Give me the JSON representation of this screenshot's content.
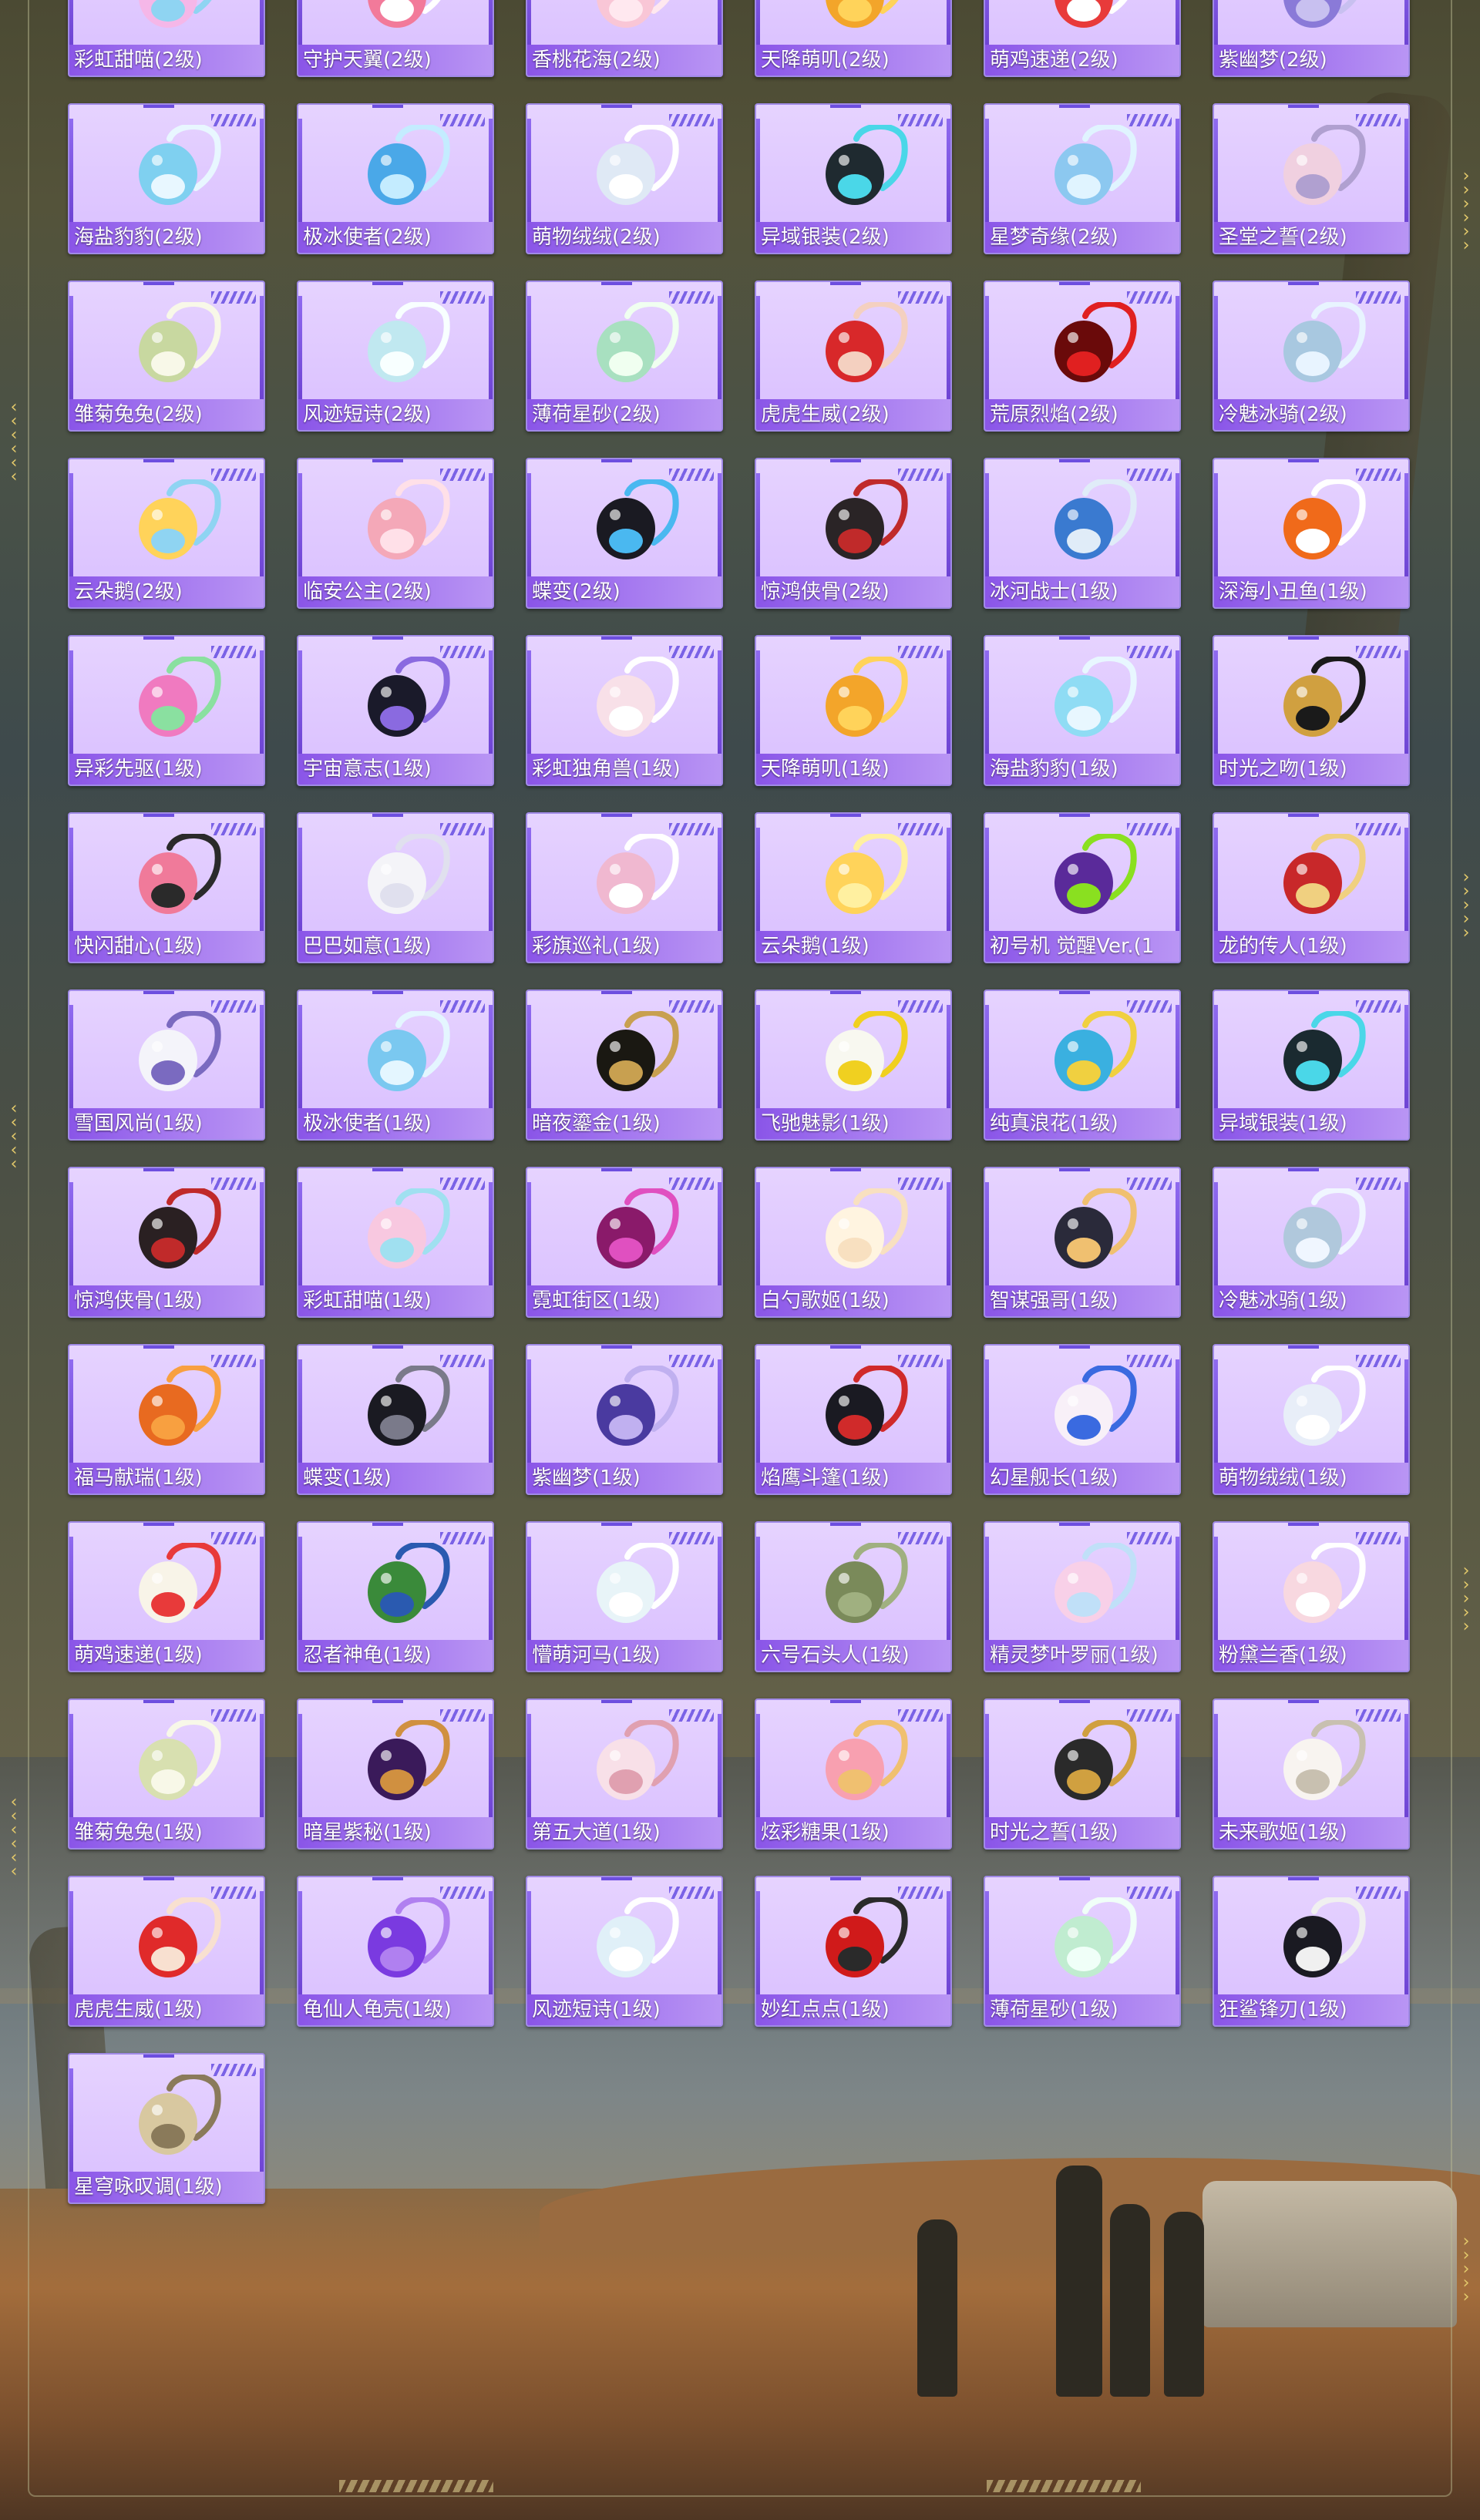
{
  "colors": {
    "card_bg": "#dcc4ff",
    "label_bar": "#9a68ee",
    "accent": "#6d4ee0",
    "frame_gold": "#e2c86a"
  },
  "items": [
    {
      "name": "彩虹甜喵(2级)",
      "icon": "rainbow-cat-backpack-icon",
      "c1": "#f5b7e8",
      "c2": "#8fd4f2"
    },
    {
      "name": "守护天翼(2级)",
      "icon": "guardian-wing-backpack-icon",
      "c1": "#f27a9a",
      "c2": "#ffffff"
    },
    {
      "name": "香桃花海(2级)",
      "icon": "peach-flower-backpack-icon",
      "c1": "#f9c6d6",
      "c2": "#ffe8ef"
    },
    {
      "name": "天降萌叽(2级)",
      "icon": "cute-chick-backpack-icon",
      "c1": "#f3a52a",
      "c2": "#ffd35a"
    },
    {
      "name": "萌鸡速递(2级)",
      "icon": "chick-delivery-backpack-icon",
      "c1": "#e83a3a",
      "c2": "#ffffff"
    },
    {
      "name": "紫幽梦(2级)",
      "icon": "purple-dream-backpack-icon",
      "c1": "#8a7ad8",
      "c2": "#c8c0f0"
    },
    {
      "name": "海盐豹豹(2级)",
      "icon": "sea-salt-seal-backpack-icon",
      "c1": "#7fd0f0",
      "c2": "#e8f7ff"
    },
    {
      "name": "极冰使者(2级)",
      "icon": "ice-envoy-backpack-icon",
      "c1": "#4aa8e8",
      "c2": "#c4ecff"
    },
    {
      "name": "萌物绒绒(2级)",
      "icon": "plush-pet-backpack-icon",
      "c1": "#dfe9f5",
      "c2": "#ffffff"
    },
    {
      "name": "异域银装(2级)",
      "icon": "exotic-silver-backpack-icon",
      "c1": "#1f2a30",
      "c2": "#4ad7e8"
    },
    {
      "name": "星梦奇缘(2级)",
      "icon": "star-dream-backpack-icon",
      "c1": "#8cc8f0",
      "c2": "#e0f4ff"
    },
    {
      "name": "圣堂之誓(2级)",
      "icon": "sanctum-oath-backpack-icon",
      "c1": "#f0d0e0",
      "c2": "#b0a0d0"
    },
    {
      "name": "雏菊兔兔(2级)",
      "icon": "daisy-bunny-backpack-icon",
      "c1": "#c8d8a0",
      "c2": "#f8f8e8"
    },
    {
      "name": "风迹短诗(2级)",
      "icon": "wind-poem-backpack-icon",
      "c1": "#c0e8f0",
      "c2": "#f8ffff"
    },
    {
      "name": "薄荷星砂(2级)",
      "icon": "mint-stardust-backpack-icon",
      "c1": "#a8e0c0",
      "c2": "#f0fff0"
    },
    {
      "name": "虎虎生威(2级)",
      "icon": "tiger-backpack-icon",
      "c1": "#d8282a",
      "c2": "#f4d0c0"
    },
    {
      "name": "荒原烈焰(2级)",
      "icon": "wasteland-flame-backpack-icon",
      "c1": "#6a0a0a",
      "c2": "#e02020"
    },
    {
      "name": "冷魅冰骑(2级)",
      "icon": "ice-knight-backpack-icon",
      "c1": "#a8c8e0",
      "c2": "#e8f4ff"
    },
    {
      "name": "云朵鹅(2级)",
      "icon": "cloud-goose-backpack-icon",
      "c1": "#ffd35a",
      "c2": "#8fd4f2"
    },
    {
      "name": "临安公主(2级)",
      "icon": "linan-princess-backpack-icon",
      "c1": "#f4a8b8",
      "c2": "#ffe0e8"
    },
    {
      "name": "蝶变(2级)",
      "icon": "butterfly-backpack-icon",
      "c1": "#1a1a22",
      "c2": "#4ab8f0"
    },
    {
      "name": "惊鸿侠骨(2级)",
      "icon": "swift-hero-backpack-icon",
      "c1": "#2a2426",
      "c2": "#c02a2a"
    },
    {
      "name": "冰河战士(1级)",
      "icon": "glacier-warrior-backpack-icon",
      "c1": "#3a7ad0",
      "c2": "#e0ecf8"
    },
    {
      "name": "深海小丑鱼(1级)",
      "icon": "clownfish-backpack-icon",
      "c1": "#f06a1a",
      "c2": "#ffffff"
    },
    {
      "name": "异彩先驱(1级)",
      "icon": "colorful-pioneer-backpack-icon",
      "c1": "#f07ac0",
      "c2": "#8ae0a0"
    },
    {
      "name": "宇宙意志(1级)",
      "icon": "cosmic-will-backpack-icon",
      "c1": "#1a1a2a",
      "c2": "#8a6ae0"
    },
    {
      "name": "彩虹独角兽(1级)",
      "icon": "unicorn-backpack-icon",
      "c1": "#f8e0e8",
      "c2": "#ffffff"
    },
    {
      "name": "天降萌叽(1级)",
      "icon": "cute-chick-backpack-icon",
      "c1": "#f3a52a",
      "c2": "#ffd35a"
    },
    {
      "name": "海盐豹豹(1级)",
      "icon": "sea-salt-seal-backpack-icon",
      "c1": "#8fdcf4",
      "c2": "#e8f7ff"
    },
    {
      "name": "时光之吻(1级)",
      "icon": "time-kiss-backpack-icon",
      "c1": "#d0a040",
      "c2": "#1a1a1a"
    },
    {
      "name": "快闪甜心(1级)",
      "icon": "flash-sweetheart-backpack-icon",
      "c1": "#f07a9a",
      "c2": "#2a2a2a"
    },
    {
      "name": "巴巴如意(1级)",
      "icon": "baba-ruyi-backpack-icon",
      "c1": "#f4f4f8",
      "c2": "#e0e0ee"
    },
    {
      "name": "彩旗巡礼(1级)",
      "icon": "flag-parade-backpack-icon",
      "c1": "#f0b8d0",
      "c2": "#ffffff"
    },
    {
      "name": "云朵鹅(1级)",
      "icon": "cloud-goose-backpack-icon",
      "c1": "#ffd35a",
      "c2": "#fff0a0"
    },
    {
      "name": "初号机 觉醒Ver.(1",
      "icon": "unit-01-backpack-icon",
      "c1": "#5a2a9a",
      "c2": "#8ae020"
    },
    {
      "name": "龙的传人(1级)",
      "icon": "dragon-heir-backpack-icon",
      "c1": "#c8282a",
      "c2": "#f0d080"
    },
    {
      "name": "雪国风尚(1级)",
      "icon": "snow-style-backpack-icon",
      "c1": "#f4f4fa",
      "c2": "#7a6ac0"
    },
    {
      "name": "极冰使者(1级)",
      "icon": "ice-envoy-backpack-icon",
      "c1": "#7ac8f0",
      "c2": "#e4f6ff"
    },
    {
      "name": "暗夜鎏金(1级)",
      "icon": "dark-gold-backpack-icon",
      "c1": "#1a1812",
      "c2": "#c8a050"
    },
    {
      "name": "飞驰魅影(1级)",
      "icon": "speed-phantom-backpack-icon",
      "c1": "#f8f8f0",
      "c2": "#f0d020"
    },
    {
      "name": "纯真浪花(1级)",
      "icon": "pure-wave-backpack-icon",
      "c1": "#3ab0e0",
      "c2": "#f0d040"
    },
    {
      "name": "异域银装(1级)",
      "icon": "exotic-silver-backpack-icon",
      "c1": "#1a2a30",
      "c2": "#4ad7e8"
    },
    {
      "name": "惊鸿侠骨(1级)",
      "icon": "swift-hero-backpack-icon",
      "c1": "#2a2022",
      "c2": "#c02a2a"
    },
    {
      "name": "彩虹甜喵(1级)",
      "icon": "rainbow-cat-backpack-icon",
      "c1": "#f8c8e0",
      "c2": "#a0e0f0"
    },
    {
      "name": "霓虹街区(1级)",
      "icon": "neon-street-backpack-icon",
      "c1": "#8a1a6a",
      "c2": "#e050c0"
    },
    {
      "name": "白勺歌姬(1级)",
      "icon": "white-diva-backpack-icon",
      "c1": "#fff4e0",
      "c2": "#f8e0c0"
    },
    {
      "name": "智谋强哥(1级)",
      "icon": "clever-bro-backpack-icon",
      "c1": "#2a2a3a",
      "c2": "#f0c070"
    },
    {
      "name": "冷魅冰骑(1级)",
      "icon": "ice-knight-backpack-icon",
      "c1": "#b0c8dc",
      "c2": "#f0f6ff"
    },
    {
      "name": "福马献瑞(1级)",
      "icon": "lucky-horse-backpack-icon",
      "c1": "#e86a20",
      "c2": "#f8a040"
    },
    {
      "name": "蝶变(1级)",
      "icon": "butterfly-backpack-icon",
      "c1": "#1a1a22",
      "c2": "#7a7a8a"
    },
    {
      "name": "紫幽梦(1级)",
      "icon": "purple-dream-backpack-icon",
      "c1": "#4a3aa0",
      "c2": "#c0b0f0"
    },
    {
      "name": "焰鹰斗篷(1级)",
      "icon": "flame-eagle-backpack-icon",
      "c1": "#1a1a22",
      "c2": "#d02a2a"
    },
    {
      "name": "幻星舰长(1级)",
      "icon": "star-captain-backpack-icon",
      "c1": "#f8f0f8",
      "c2": "#3a6ae0"
    },
    {
      "name": "萌物绒绒(1级)",
      "icon": "plush-pet-backpack-icon",
      "c1": "#e8eef8",
      "c2": "#ffffff"
    },
    {
      "name": "萌鸡速递(1级)",
      "icon": "chick-delivery-backpack-icon",
      "c1": "#f8f4e8",
      "c2": "#e83a3a"
    },
    {
      "name": "忍者神龟(1级)",
      "icon": "ninja-turtle-backpack-icon",
      "c1": "#3a8a3a",
      "c2": "#2a5ab0"
    },
    {
      "name": "懵萌河马(1级)",
      "icon": "hippo-backpack-icon",
      "c1": "#e8f4f8",
      "c2": "#ffffff"
    },
    {
      "name": "六号石头人(1级)",
      "icon": "stone-golem-backpack-icon",
      "c1": "#7a8a5a",
      "c2": "#a0b080"
    },
    {
      "name": "精灵梦叶罗丽(1级)",
      "icon": "fairy-dream-backpack-icon",
      "c1": "#f8d0e8",
      "c2": "#c0e0f8"
    },
    {
      "name": "粉黛兰香(1级)",
      "icon": "pink-orchid-backpack-icon",
      "c1": "#f8d8e0",
      "c2": "#ffffff"
    },
    {
      "name": "雏菊兔兔(1级)",
      "icon": "daisy-bunny-backpack-icon",
      "c1": "#d8e0b0",
      "c2": "#f8f8e8"
    },
    {
      "name": "暗星紫秘(1级)",
      "icon": "dark-star-backpack-icon",
      "c1": "#3a1a5a",
      "c2": "#d09040"
    },
    {
      "name": "第五大道(1级)",
      "icon": "fifth-avenue-backpack-icon",
      "c1": "#f8e0e8",
      "c2": "#e0a0b0"
    },
    {
      "name": "炫彩糖果(1级)",
      "icon": "candy-backpack-icon",
      "c1": "#f8a0b0",
      "c2": "#f0c070"
    },
    {
      "name": "时光之誓(1级)",
      "icon": "time-oath-backpack-icon",
      "c1": "#2a2a2a",
      "c2": "#d0a040"
    },
    {
      "name": "未来歌姬(1级)",
      "icon": "future-diva-backpack-icon",
      "c1": "#f8f4f0",
      "c2": "#c8c0b0"
    },
    {
      "name": "虎虎生威(1级)",
      "icon": "tiger-backpack-icon",
      "c1": "#e02a2a",
      "c2": "#f8e0d0"
    },
    {
      "name": "龟仙人龟壳(1级)",
      "icon": "turtle-shell-backpack-icon",
      "c1": "#7a3ae0",
      "c2": "#b080f0"
    },
    {
      "name": "风迹短诗(1级)",
      "icon": "wind-poem-backpack-icon",
      "c1": "#e0f0f8",
      "c2": "#ffffff"
    },
    {
      "name": "妙红点点(1级)",
      "icon": "red-dots-backpack-icon",
      "c1": "#d01a1a",
      "c2": "#2a2a2a"
    },
    {
      "name": "薄荷星砂(1级)",
      "icon": "mint-stardust-backpack-icon",
      "c1": "#c0ecd0",
      "c2": "#f0fff8"
    },
    {
      "name": "狂鲨锋刃(1级)",
      "icon": "shark-blade-backpack-icon",
      "c1": "#1a1a22",
      "c2": "#f0f0f0"
    },
    {
      "name": "星穹咏叹调(1级)",
      "icon": "star-aria-backpack-icon",
      "c1": "#d8c8a0",
      "c2": "#8a7a5a"
    }
  ]
}
